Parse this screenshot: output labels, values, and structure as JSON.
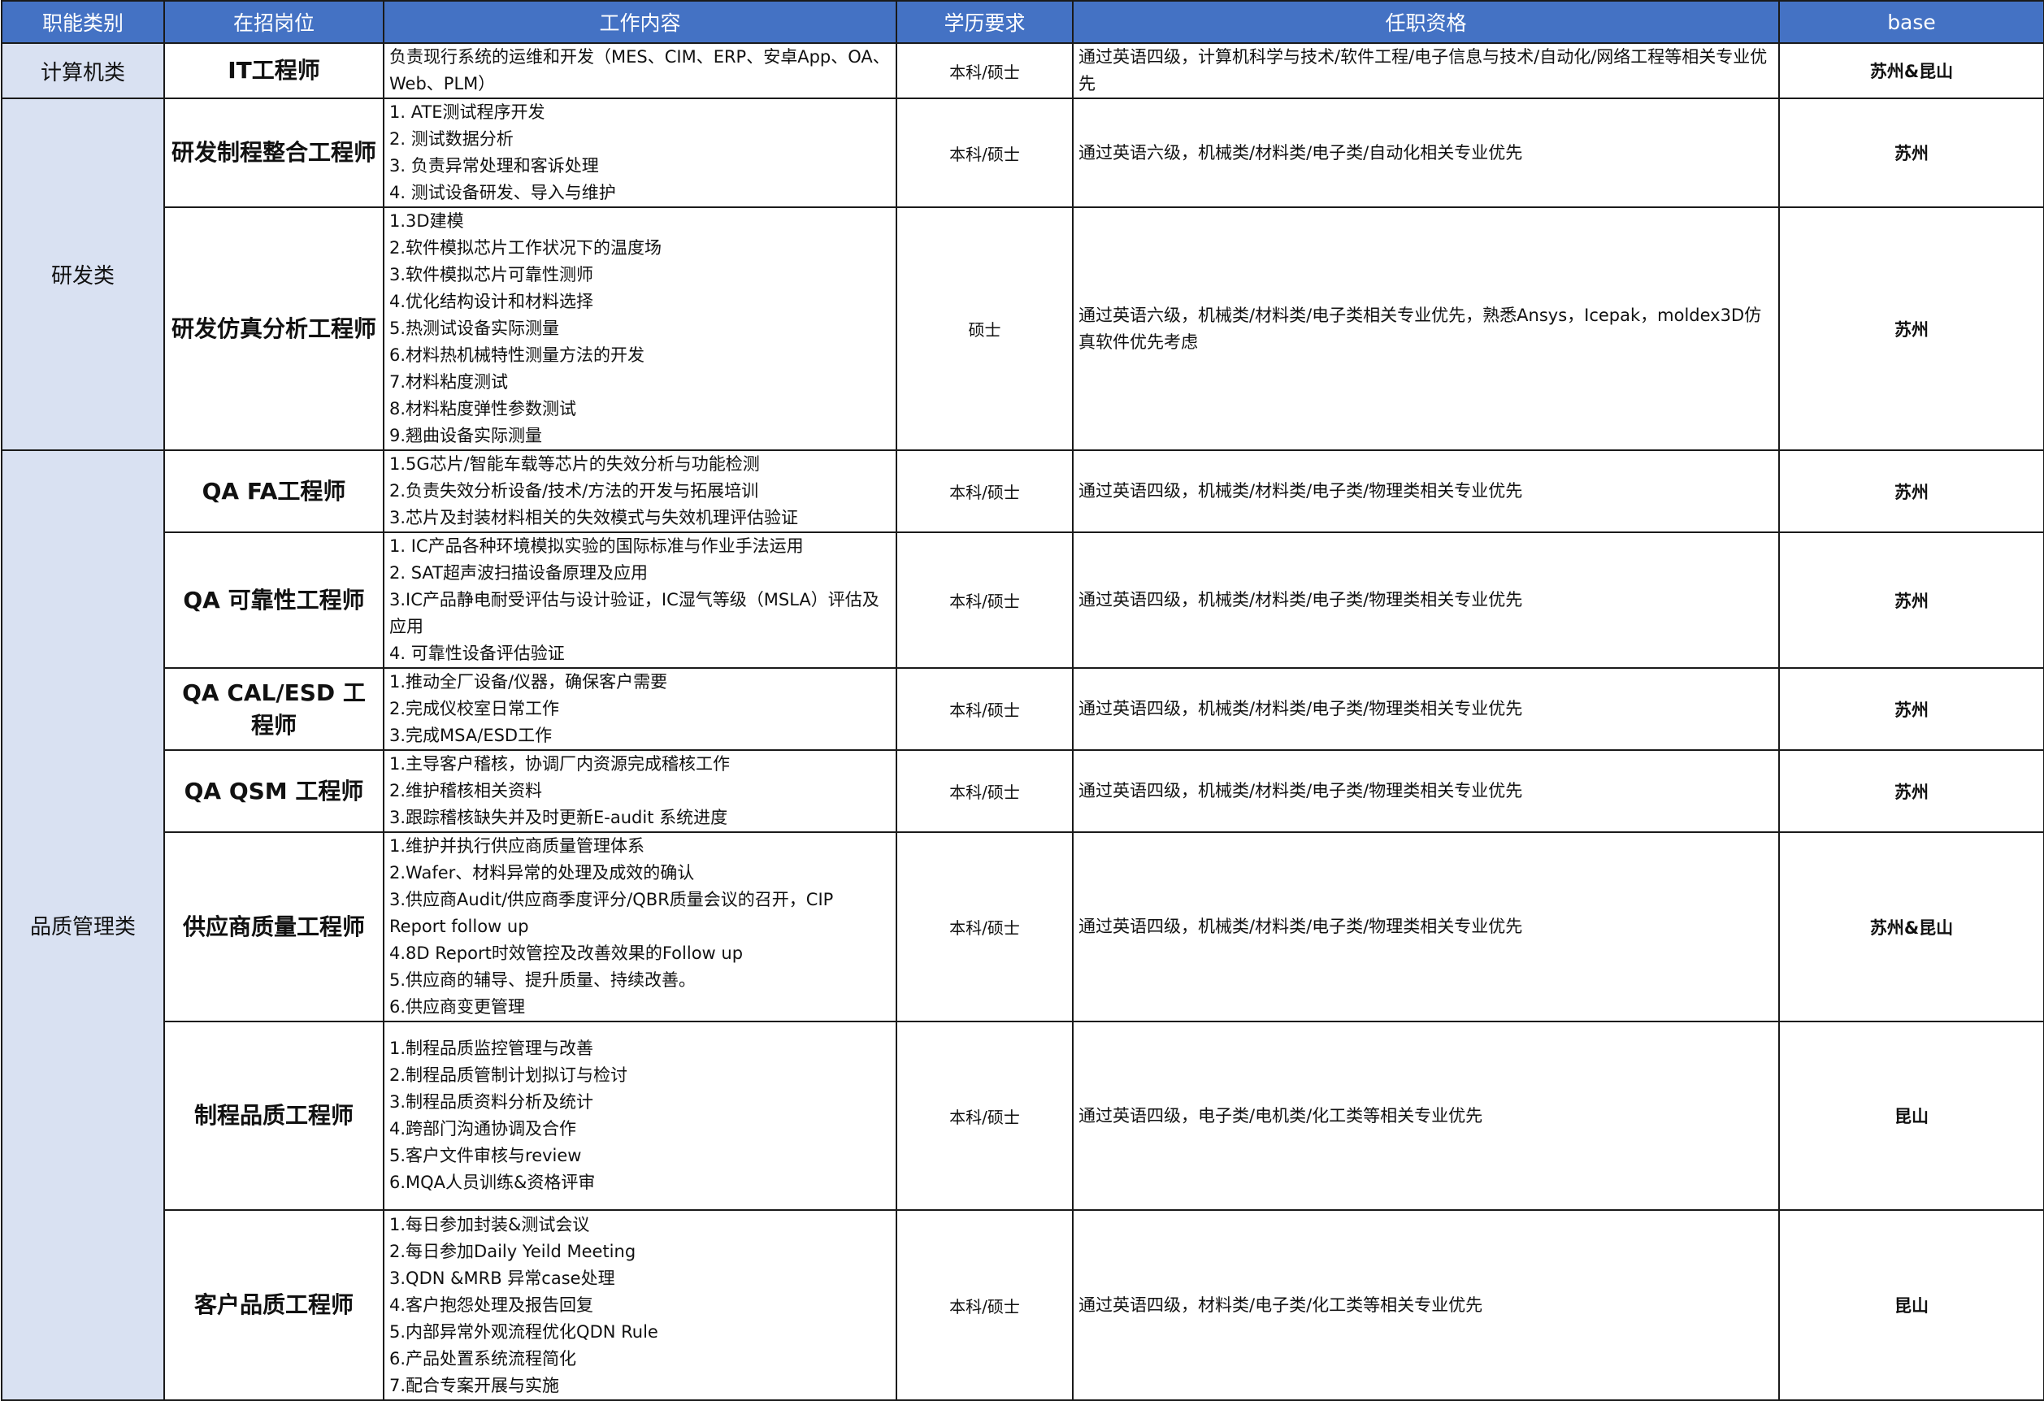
{
  "headers": [
    "职能类别",
    "在招岗位",
    "工作内容",
    "学历要求",
    "任职资格",
    "base"
  ],
  "categories": {
    "computer": "计算机类",
    "rd": "研发类",
    "qa": "品质管理类"
  },
  "rows": [
    {
      "position": "IT工程师",
      "content": [
        "负责现行系统的运维和开发（MES、CIM、ERP、安卓App、OA、Web、PLM）"
      ],
      "education": "本科/硕士",
      "qualification": "通过英语四级，计算机科学与技术/软件工程/电子信息与技术/自动化/网络工程等相关专业优先",
      "base": "苏州&昆山"
    },
    {
      "position": "研发制程整合工程师",
      "content": [
        "1. ATE测试程序开发",
        "2. 测试数据分析",
        "3. 负责异常处理和客诉处理",
        "4. 测试设备研发、导入与维护"
      ],
      "education": "本科/硕士",
      "qualification": "通过英语六级，机械类/材料类/电子类/自动化相关专业优先",
      "base": "苏州"
    },
    {
      "position": "研发仿真分析工程师",
      "content": [
        "1.3D建模",
        "2.软件模拟芯片工作状况下的温度场",
        "3.软件模拟芯片可靠性测师",
        "4.优化结构设计和材料选择",
        "5.热测试设备实际测量",
        "6.材料热机械特性测量方法的开发",
        "7.材料粘度测试",
        "8.材料粘度弹性参数测试",
        "9.翘曲设备实际测量"
      ],
      "education": "硕士",
      "qualification": "通过英语六级，机械类/材料类/电子类相关专业优先，熟悉Ansys，Icepak，moldex3D仿真软件优先考虑",
      "base": "苏州"
    },
    {
      "position": "QA FA工程师",
      "content": [
        "1.5G芯片/智能车载等芯片的失效分析与功能检测",
        "2.负责失效分析设备/技术/方法的开发与拓展培训",
        "3.芯片及封装材料相关的失效模式与失效机理评估验证"
      ],
      "education": "本科/硕士",
      "qualification": "通过英语四级，机械类/材料类/电子类/物理类相关专业优先",
      "base": "苏州"
    },
    {
      "position": "QA 可靠性工程师",
      "content": [
        "1. IC产品各种环境模拟实验的国际标准与作业手法运用",
        "2. SAT超声波扫描设备原理及应用",
        "3.IC产品静电耐受评估与设计验证，IC湿气等级（MSLA）评估及应用",
        "4. 可靠性设备评估验证"
      ],
      "education": "本科/硕士",
      "qualification": "通过英语四级，机械类/材料类/电子类/物理类相关专业优先",
      "base": "苏州"
    },
    {
      "position": "QA CAL/ESD 工程师",
      "content": [
        "1.推动全厂设备/仪器，确保客户需要",
        "2.完成仪校室日常工作",
        "3.完成MSA/ESD工作"
      ],
      "education": "本科/硕士",
      "qualification": "通过英语四级，机械类/材料类/电子类/物理类相关专业优先",
      "base": "苏州"
    },
    {
      "position": "QA QSM 工程师",
      "content": [
        "1.主导客户稽核，协调厂内资源完成稽核工作",
        "2.维护稽核相关资料",
        "3.跟踪稽核缺失并及时更新E-audit 系统进度"
      ],
      "education": "本科/硕士",
      "qualification": "通过英语四级，机械类/材料类/电子类/物理类相关专业优先",
      "base": "苏州"
    },
    {
      "position": "供应商质量工程师",
      "content": [
        "1.维护并执行供应商质量管理体系",
        "2.Wafer、材料异常的处理及成效的确认",
        "3.供应商Audit/供应商季度评分/QBR质量会议的召开，CIP Report follow up",
        "4.8D Report时效管控及改善效果的Follow up",
        "5.供应商的辅导、提升质量、持续改善。",
        "6.供应商变更管理"
      ],
      "education": "本科/硕士",
      "qualification": "通过英语四级，机械类/材料类/电子类/物理类相关专业优先",
      "base": "苏州&昆山"
    },
    {
      "position": "制程品质工程师",
      "content": [
        "1.制程品质监控管理与改善",
        "2.制程品质管制计划拟订与检讨",
        "3.制程品质资料分析及统计",
        "4.跨部门沟通协调及合作",
        "5.客户文件审核与review",
        "6.MQA人员训练&资格评审"
      ],
      "education": "本科/硕士",
      "qualification": "通过英语四级，电子类/电机类/化工类等相关专业优先",
      "base": "昆山"
    },
    {
      "position": "客户品质工程师",
      "content": [
        "1.每日参加封装&测试会议",
        "2.每日参加Daily Yeild Meeting",
        "3.QDN &MRB 异常case处理",
        "4.客户抱怨处理及报告回复",
        "5.内部异常外观流程优化QDN Rule",
        "6.产品处置系统流程简化",
        "7.配合专案开展与实施"
      ],
      "education": "本科/硕士",
      "qualification": "通过英语四级，材料类/电子类/化工类等相关专业优先",
      "base": "昆山"
    }
  ]
}
